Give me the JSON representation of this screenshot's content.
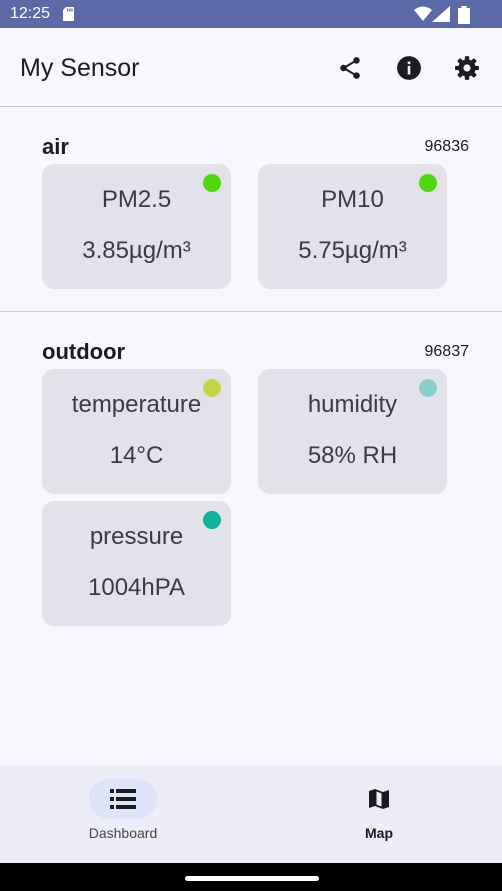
{
  "status_bar": {
    "time": "12:25"
  },
  "app_bar": {
    "title": "My Sensor"
  },
  "sections": [
    {
      "title": "air",
      "id": "96836",
      "cards": [
        {
          "name": "PM2.5",
          "value": "3.85µg/m³",
          "indicator_color": "#4ed80b"
        },
        {
          "name": "PM10",
          "value": "5.75µg/m³",
          "indicator_color": "#4ed80b"
        }
      ]
    },
    {
      "title": "outdoor",
      "id": "96837",
      "cards": [
        {
          "name": "temperature",
          "value": "14°C",
          "indicator_color": "#c5d54a"
        },
        {
          "name": "humidity",
          "value": "58% RH",
          "indicator_color": "#87cfcb"
        },
        {
          "name": "pressure",
          "value": "1004hPA",
          "indicator_color": "#12b29a"
        }
      ]
    }
  ],
  "bottom_nav": {
    "items": [
      {
        "label": "Dashboard",
        "icon": "list-icon",
        "active": true
      },
      {
        "label": "Map",
        "icon": "map-icon",
        "active": false
      }
    ]
  }
}
